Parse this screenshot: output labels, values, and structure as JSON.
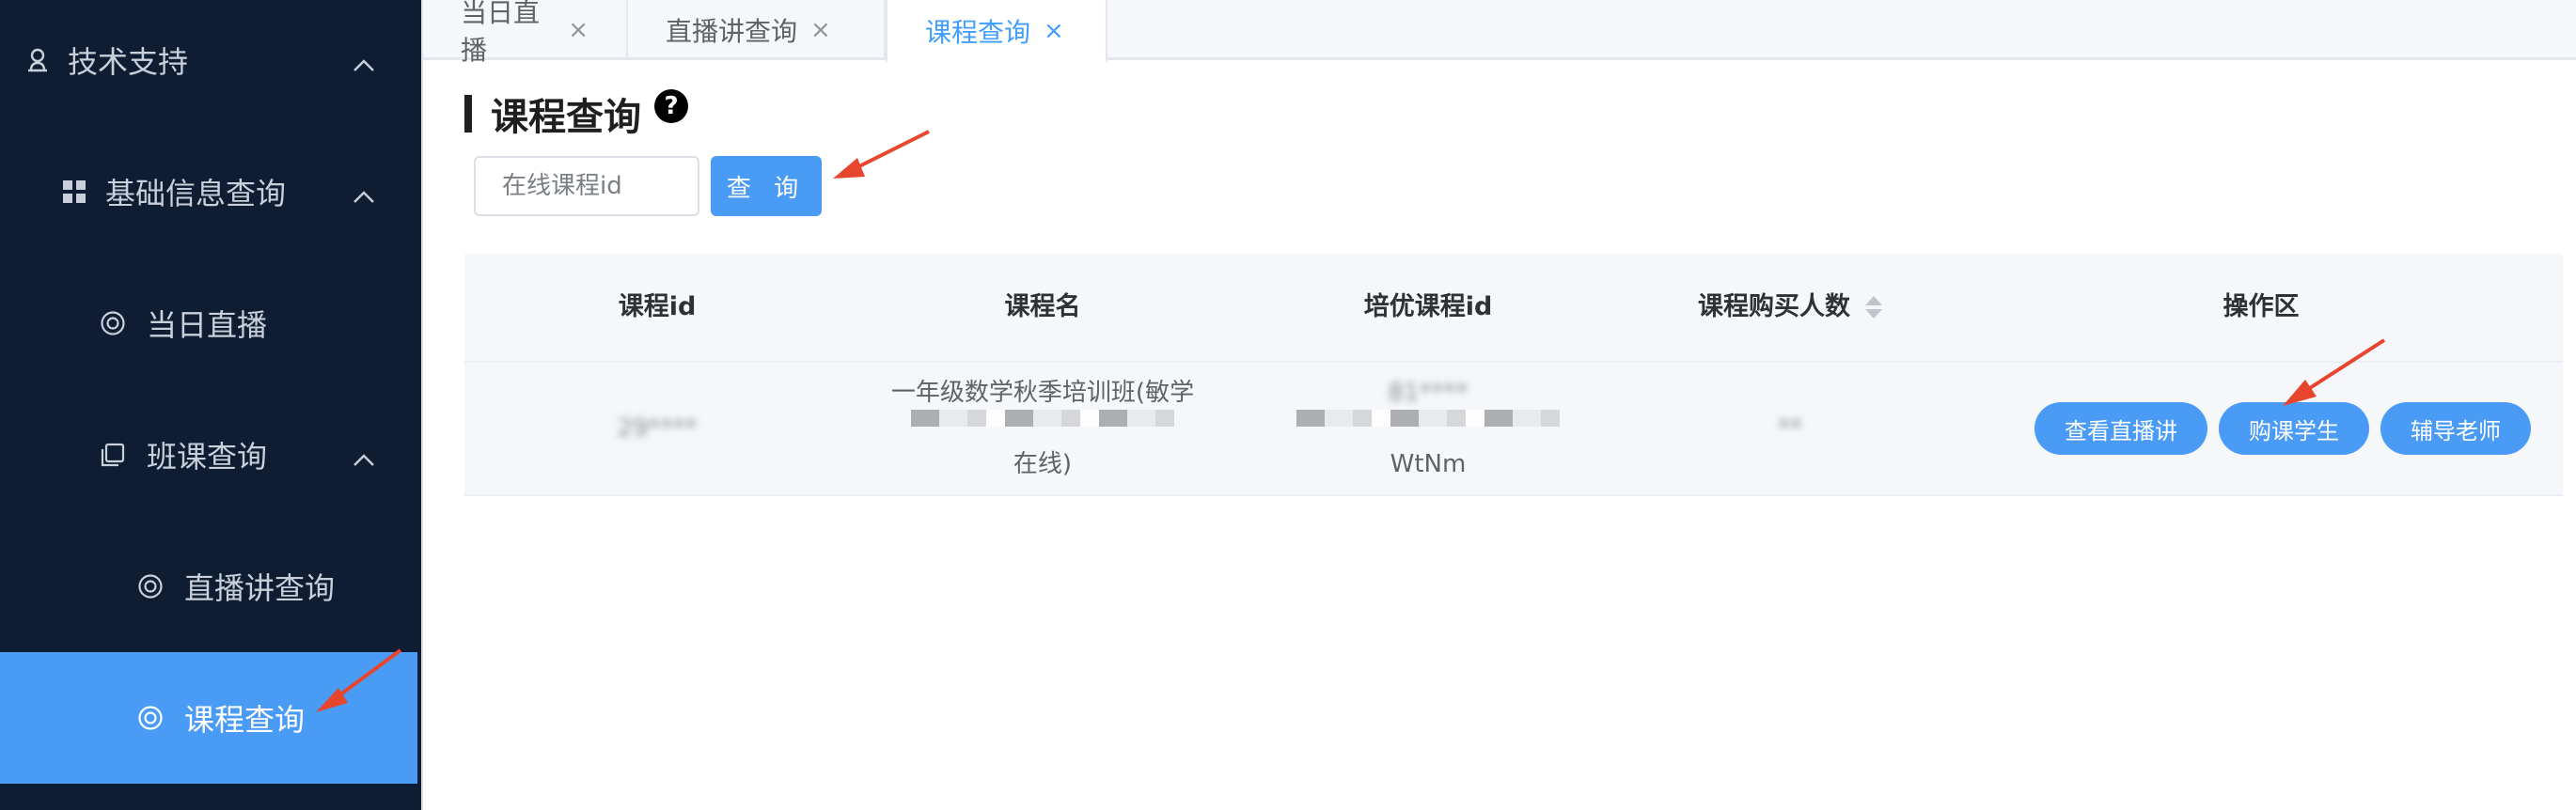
{
  "sidebar": {
    "items": [
      {
        "label": "技术支持",
        "icon": "user-icon",
        "expanded": true
      },
      {
        "label": "基础信息查询",
        "icon": "grid-icon",
        "expanded": true
      },
      {
        "label": "当日直播",
        "icon": "lifebuoy-icon"
      },
      {
        "label": "班课查询",
        "icon": "copy-icon",
        "expanded": true
      },
      {
        "label": "直播讲查询",
        "icon": "lifebuoy-icon"
      },
      {
        "label": "课程查询",
        "icon": "lifebuoy-icon",
        "active": true
      }
    ]
  },
  "tabs": [
    {
      "label": "当日直播",
      "close": "×"
    },
    {
      "label": "直播讲查询",
      "close": "×"
    },
    {
      "label": "课程查询",
      "close": "×",
      "active": true
    }
  ],
  "page": {
    "title": "课程查询",
    "help_icon": "?"
  },
  "search": {
    "placeholder": "在线课程id",
    "value": "",
    "button_label": "查 询"
  },
  "table": {
    "columns": [
      "课程id",
      "课程名",
      "培优课程id",
      "课程购买人数",
      "操作区"
    ],
    "rows": [
      {
        "course_id": "29****",
        "course_name_line1": "一年级数学秋季培训班(敏学",
        "course_name_line2": "在线)",
        "peiyou_id_line1": "81****",
        "peiyou_id_line2": "WtNm",
        "buyers": "**",
        "actions": [
          "查看直播讲",
          "购课学生",
          "辅导老师"
        ]
      }
    ]
  },
  "colors": {
    "sidebar_bg": "#0f1d32",
    "accent": "#4a9bf6",
    "arrow": "#e8452f"
  }
}
